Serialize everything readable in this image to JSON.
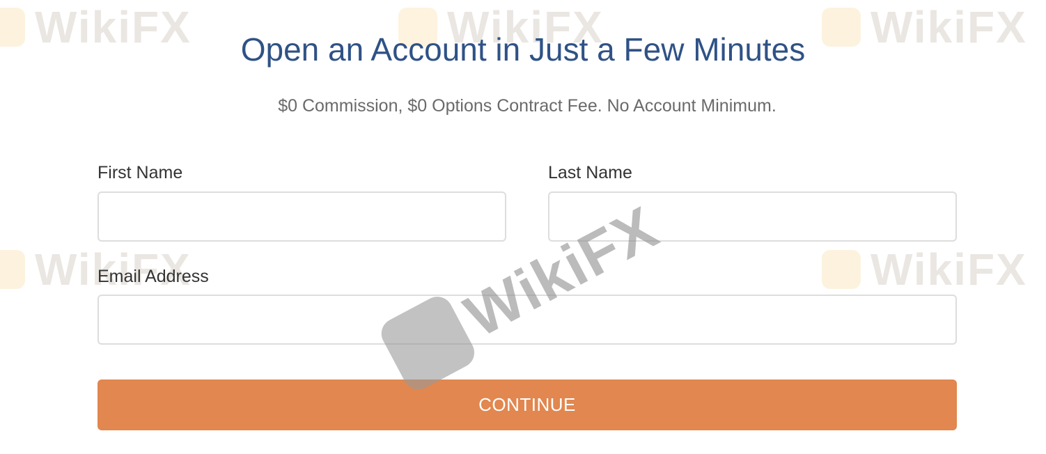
{
  "form": {
    "title": "Open an Account in Just a Few Minutes",
    "subtitle": "$0 Commission, $0 Options Contract Fee. No Account Minimum.",
    "first_name_label": "First Name",
    "first_name_value": "",
    "last_name_label": "Last Name",
    "last_name_value": "",
    "email_label": "Email Address",
    "email_value": "",
    "continue_label": "CONTINUE"
  },
  "colors": {
    "title": "#2f5286",
    "button": "#e1874f",
    "input_border": "#dddddd"
  },
  "watermark": {
    "text": "WikiFX",
    "icon": "wikifx-logo-icon"
  }
}
